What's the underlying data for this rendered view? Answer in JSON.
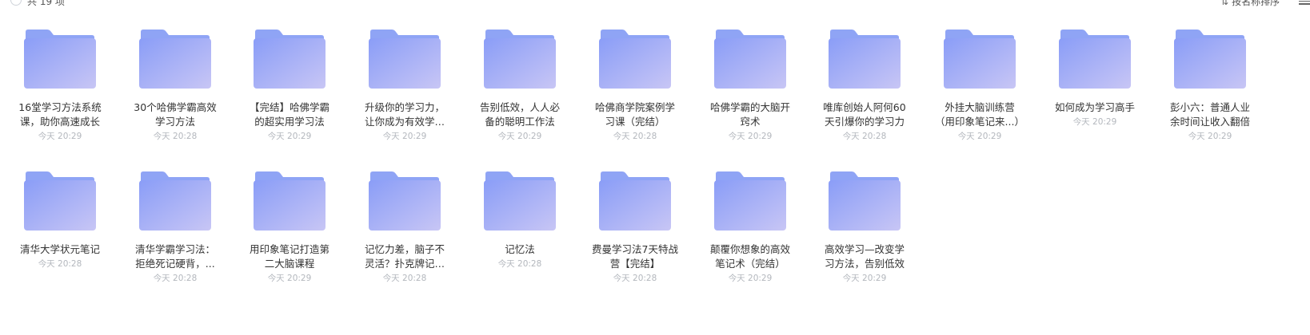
{
  "toolbar": {
    "count_label": "共 19 项",
    "sort_label": "按名称排序",
    "sort_icon": "sort-arrows-icon",
    "view_icon": "list-view-icon"
  },
  "colors": {
    "folder_back": "#8fa4f5",
    "folder_front_start": "#8a9df7",
    "folder_front_end": "#c8c6f5",
    "time_text": "#b3b7bd"
  },
  "folders": [
    {
      "name": "16堂学习方法系统课，助你高速成长",
      "time": "今天 20:29"
    },
    {
      "name": "30个哈佛学霸高效学习方法",
      "time": "今天 20:28"
    },
    {
      "name": "【完结】哈佛学霸的超实用学习法",
      "time": "今天 20:29"
    },
    {
      "name": "升级你的学习力，让你成为有效学习者",
      "time": "今天 20:29"
    },
    {
      "name": "告别低效，人人必备的聪明工作法",
      "time": "今天 20:29"
    },
    {
      "name": "哈佛商学院案例学习课（完结）",
      "time": "今天 20:28"
    },
    {
      "name": "哈佛学霸的大脑开窍术",
      "time": "今天 20:29"
    },
    {
      "name": "唯库创始人阿何60天引爆你的学习力",
      "time": "今天 20:28"
    },
    {
      "name": "外挂大脑训练营（用印象笔记来...）",
      "time": "今天 20:29"
    },
    {
      "name": "如何成为学习高手",
      "time": "今天 20:29"
    },
    {
      "name": "彭小六：普通人业余时间让收入翻倍",
      "time": "今天 20:29"
    },
    {
      "name": "清华大学状元笔记",
      "time": "今天 20:28"
    },
    {
      "name": "清华学霸学习法：拒绝死记硬背，...",
      "time": "今天 20:28"
    },
    {
      "name": "用印象笔记打造第二大脑课程",
      "time": "今天 20:29"
    },
    {
      "name": "记忆力差，脑子不灵活？扑克牌记忆法",
      "time": "今天 20:28"
    },
    {
      "name": "记忆法",
      "time": "今天 20:28"
    },
    {
      "name": "费曼学习法7天特战营【完结】",
      "time": "今天 20:28"
    },
    {
      "name": "颠覆你想象的高效笔记术（完结）",
      "time": "今天 20:29"
    },
    {
      "name": "高效学习—改变学习方法，告别低效",
      "time": "今天 20:29"
    }
  ]
}
